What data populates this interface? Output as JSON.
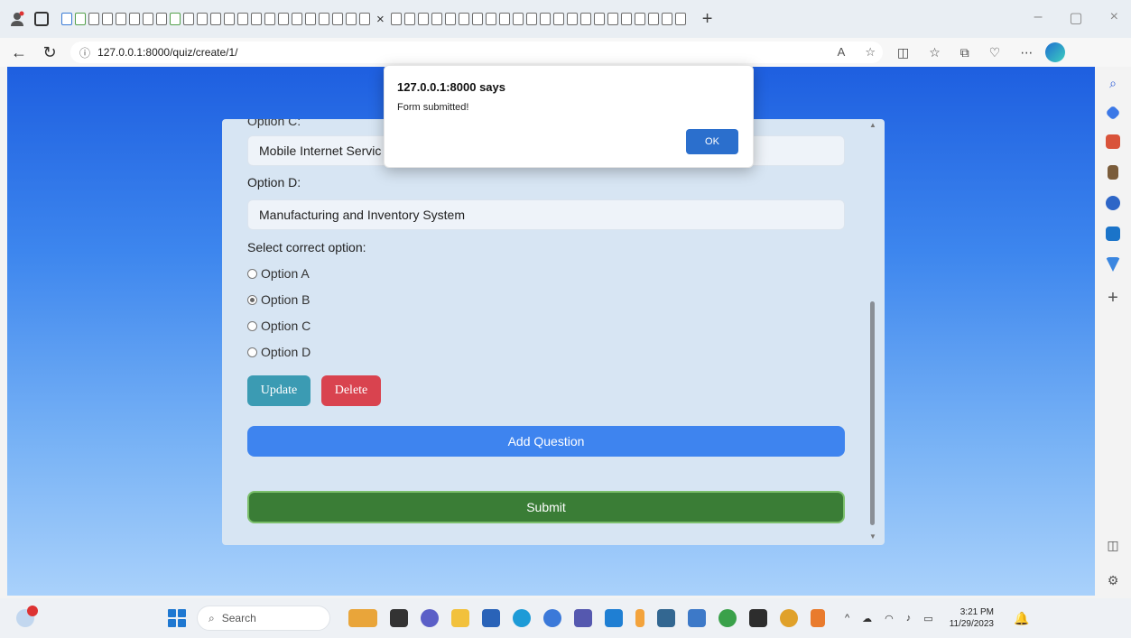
{
  "browser": {
    "address": "127.0.0.1:8000/quiz/create/1/",
    "info_icon": "info-icon",
    "tab_close": "×",
    "new_tab": "+",
    "win_minimize": "–",
    "win_restore": "▢",
    "win_close": "×"
  },
  "dialog": {
    "title": "127.0.0.1:8000 says",
    "message": "Form submitted!",
    "ok_label": "OK"
  },
  "form": {
    "cut_label": "Option C:",
    "option_c_value": "Mobile Internet Servic",
    "option_d_label": "Option D:",
    "option_d_value": "Manufacturing and Inventory System",
    "select_label": "Select correct option:",
    "options": [
      "Option A",
      "Option B",
      "Option C",
      "Option D"
    ],
    "selected": "Option B",
    "update_label": "Update",
    "delete_label": "Delete",
    "add_question_label": "Add Question",
    "submit_label": "Submit"
  },
  "taskbar": {
    "search_placeholder": "Search",
    "time": "3:21 PM",
    "date": "11/29/2023"
  },
  "colors": {
    "update": "#3b9bb3",
    "delete": "#d9434f",
    "add_question": "#3e84ef",
    "submit": "#3a7d36",
    "dialog_ok": "#2b6fcd"
  }
}
